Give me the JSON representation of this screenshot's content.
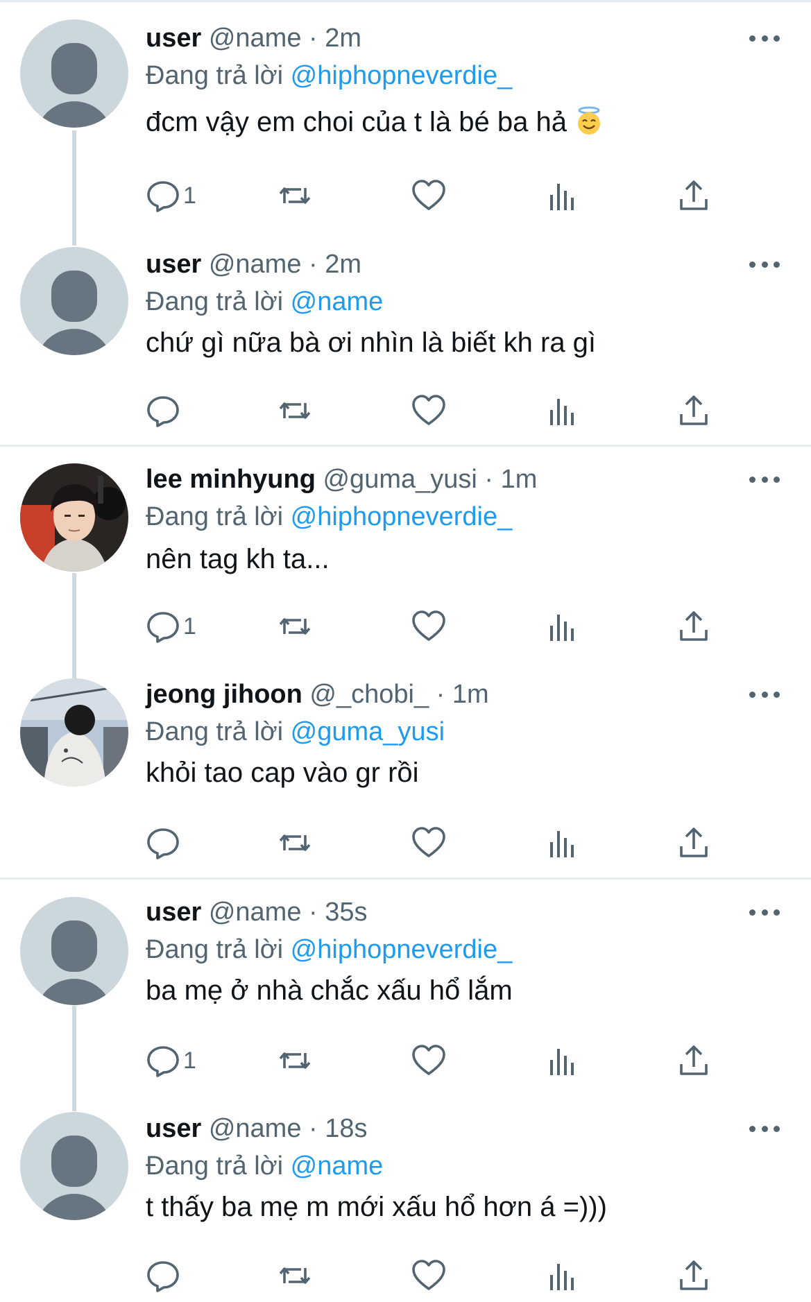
{
  "tweets": [
    {
      "display_name": "user",
      "handle": "@name",
      "time": "2m",
      "reply_prefix": "Đang trả lời",
      "reply_to": "@hiphopneverdie_",
      "text": "đcm vậy em choi của t là bé ba hả",
      "emoji": "smiling-face-with-halo",
      "reply_count": "1",
      "avatar": "default-avatar"
    },
    {
      "display_name": "user",
      "handle": "@name",
      "time": "2m",
      "reply_prefix": "Đang trả lời",
      "reply_to": "@name",
      "text": "chứ gì nữa bà ơi nhìn là biết kh ra gì",
      "reply_count": "",
      "avatar": "default-avatar"
    },
    {
      "display_name": "lee minhyung",
      "handle": "@guma_yusi",
      "time": "1m",
      "reply_prefix": "Đang trả lời",
      "reply_to": "@hiphopneverdie_",
      "text": "nên tag kh ta...",
      "reply_count": "1",
      "avatar": "photo-young-man"
    },
    {
      "display_name": "jeong jihoon",
      "handle": "@_chobi_",
      "time": "1m",
      "reply_prefix": "Đang trả lời",
      "reply_to": "@guma_yusi",
      "text": "khỏi tao cap vào gr rồi",
      "reply_count": "",
      "avatar": "photo-man-back"
    },
    {
      "display_name": "user",
      "handle": "@name",
      "time": "35s",
      "reply_prefix": "Đang trả lời",
      "reply_to": "@hiphopneverdie_",
      "text": "ba mẹ ở nhà chắc xấu hổ lắm",
      "reply_count": "1",
      "avatar": "default-avatar"
    },
    {
      "display_name": "user",
      "handle": "@name",
      "time": "18s",
      "reply_prefix": "Đang trả lời",
      "reply_to": "@name",
      "text": "t thấy ba mẹ m mới xấu hổ hơn á =)))",
      "reply_count": "",
      "avatar": "default-avatar"
    }
  ],
  "separator": "·",
  "colors": {
    "text_primary": "#0f1419",
    "text_secondary": "#536471",
    "mention": "#1d9bf0",
    "thread_line": "#cfd9de",
    "avatar_bg": "#ccd6dd",
    "avatar_fg": "#66757f"
  },
  "icons": [
    "reply-icon",
    "retweet-icon",
    "like-icon",
    "views-icon",
    "share-icon",
    "more-icon"
  ]
}
